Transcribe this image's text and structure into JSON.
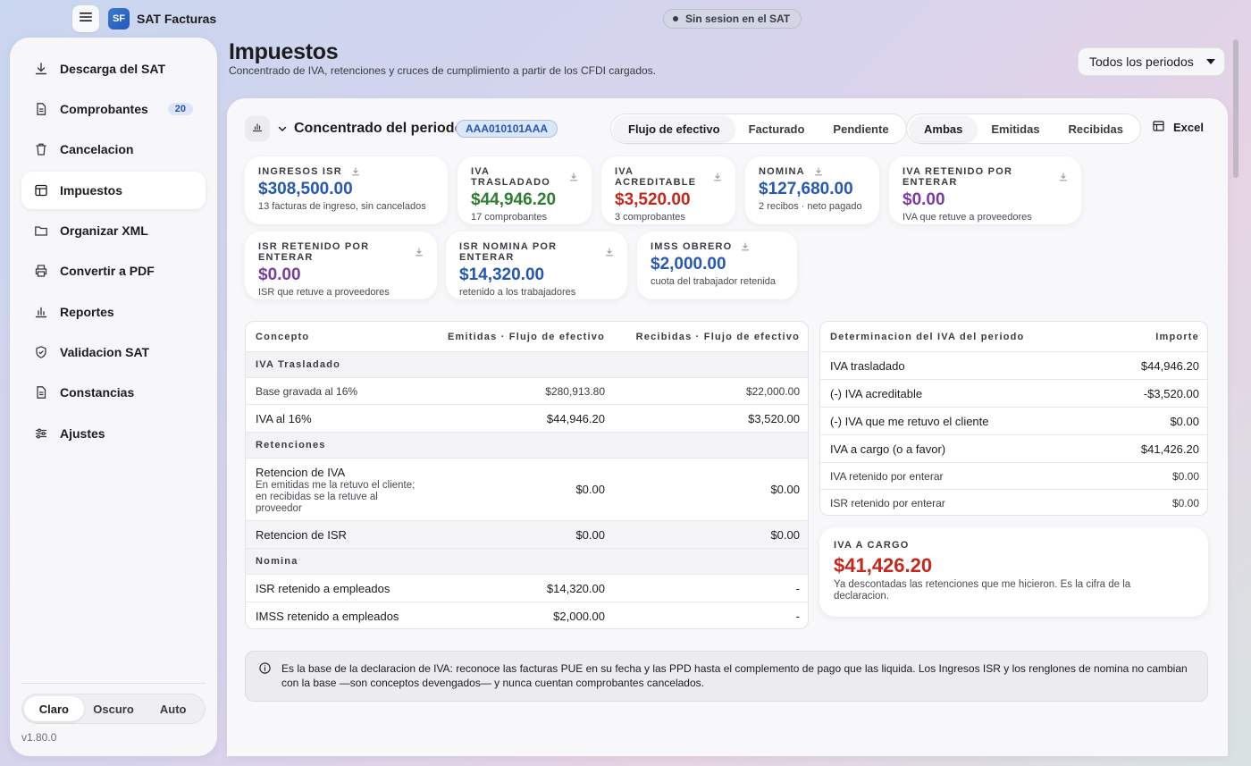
{
  "app": {
    "logo": "SF",
    "title": "SAT Facturas",
    "session_status": "Sin sesion en el SAT",
    "version": "v1.80.0"
  },
  "sidebar": {
    "items": [
      {
        "label": "Descarga del SAT",
        "icon": "download-icon"
      },
      {
        "label": "Comprobantes",
        "icon": "document-icon",
        "badge": "20"
      },
      {
        "label": "Cancelacion",
        "icon": "trash-icon"
      },
      {
        "label": "Impuestos",
        "icon": "table-icon",
        "active": true
      },
      {
        "label": "Organizar XML",
        "icon": "folder-icon"
      },
      {
        "label": "Convertir a PDF",
        "icon": "printer-icon"
      },
      {
        "label": "Reportes",
        "icon": "bar-chart-icon"
      },
      {
        "label": "Validacion SAT",
        "icon": "shield-check-icon"
      },
      {
        "label": "Constancias",
        "icon": "document-icon"
      },
      {
        "label": "Ajustes",
        "icon": "sliders-icon"
      }
    ],
    "theme": {
      "options": [
        "Claro",
        "Oscuro",
        "Auto"
      ],
      "selected": "Claro"
    }
  },
  "header": {
    "title": "Impuestos",
    "subtitle": "Concentrado de IVA, retenciones y cruces de cumplimiento a partir de los CFDI cargados.",
    "period_select": "Todos los periodos"
  },
  "toolbar": {
    "section_title": "Concentrado del periodo",
    "rfc": "AAA010101AAA",
    "basis": {
      "options": [
        "Flujo de efectivo",
        "Facturado",
        "Pendiente"
      ],
      "selected": "Flujo de efectivo"
    },
    "direction": {
      "options": [
        "Ambas",
        "Emitidas",
        "Recibidas"
      ],
      "selected": "Ambas"
    },
    "excel_label": "Excel"
  },
  "cards": [
    {
      "label": "Ingresos ISR",
      "value": "$308,500.00",
      "sub": "13 facturas de ingreso, sin cancelados",
      "color": "#2557b5"
    },
    {
      "label": "IVA Trasladado",
      "value": "$44,946.20",
      "sub": "17 comprobantes",
      "color": "#2e7d32"
    },
    {
      "label": "IVA Acreditable",
      "value": "$3,520.00",
      "sub": "3 comprobantes",
      "color": "#c4281c"
    },
    {
      "label": "Nomina",
      "value": "$127,680.00",
      "sub": "2 recibos · neto pagado",
      "color": "#2557b5"
    },
    {
      "label": "IVA Retenido por enterar",
      "value": "$0.00",
      "sub": "IVA que retuve a proveedores",
      "color": "#7a3ca3"
    },
    {
      "label": "ISR Retenido por enterar",
      "value": "$0.00",
      "sub": "ISR que retuve a proveedores",
      "color": "#7a3ca3"
    },
    {
      "label": "ISR Nomina por enterar",
      "value": "$14,320.00",
      "sub": "retenido a los trabajadores",
      "color": "#2557b5"
    },
    {
      "label": "IMSS Obrero",
      "value": "$2,000.00",
      "sub": "cuota del trabajador retenida",
      "color": "#2557b5"
    }
  ],
  "concept_table": {
    "headers": [
      "Concepto",
      "Emitidas · Flujo de efectivo",
      "Recibidas · Flujo de efectivo"
    ],
    "sections": {
      "iva": "IVA Trasladado",
      "retenciones": "Retenciones",
      "nomina": "Nomina"
    },
    "rows": {
      "base": [
        "Base gravada al 16%",
        "$280,913.80",
        "$22,000.00"
      ],
      "iva16": [
        "IVA al 16%",
        "$44,946.20",
        "$3,520.00"
      ],
      "ret_iva": [
        "Retencion de IVA",
        "$0.00",
        "$0.00"
      ],
      "ret_iva_note": "En emitidas me la retuvo el cliente; en recibidas se la retuve al proveedor",
      "ret_isr": [
        "Retencion de ISR",
        "$0.00",
        "$0.00"
      ],
      "isr_emp": [
        "ISR retenido a empleados",
        "$14,320.00",
        "-"
      ],
      "imss_emp": [
        "IMSS retenido a empleados",
        "$2,000.00",
        "-"
      ]
    }
  },
  "iva_table": {
    "headers": [
      "Determinacion del IVA del periodo",
      "Importe"
    ],
    "rows": [
      [
        "IVA trasladado",
        "$44,946.20"
      ],
      [
        "(-) IVA acreditable",
        "-$3,520.00"
      ],
      [
        "(-) IVA que me retuvo el cliente",
        "$0.00"
      ],
      [
        "IVA a cargo (o a favor)",
        "$41,426.20"
      ],
      [
        "IVA retenido por enterar",
        "$0.00"
      ],
      [
        "ISR retenido por enterar",
        "$0.00"
      ]
    ]
  },
  "iva_card": {
    "label": "IVA a cargo",
    "value": "$41,426.20",
    "description": "Ya descontadas las retenciones que me hicieron. Es la cifra de la declaracion."
  },
  "info_note": "Es la base de la declaracion de IVA: reconoce las facturas PUE en su fecha y las PPD hasta el complemento de pago que las liquida. Los Ingresos ISR y los renglones de nomina no cambian con la base —son conceptos devengados— y nunca cuentan comprobantes cancelados."
}
